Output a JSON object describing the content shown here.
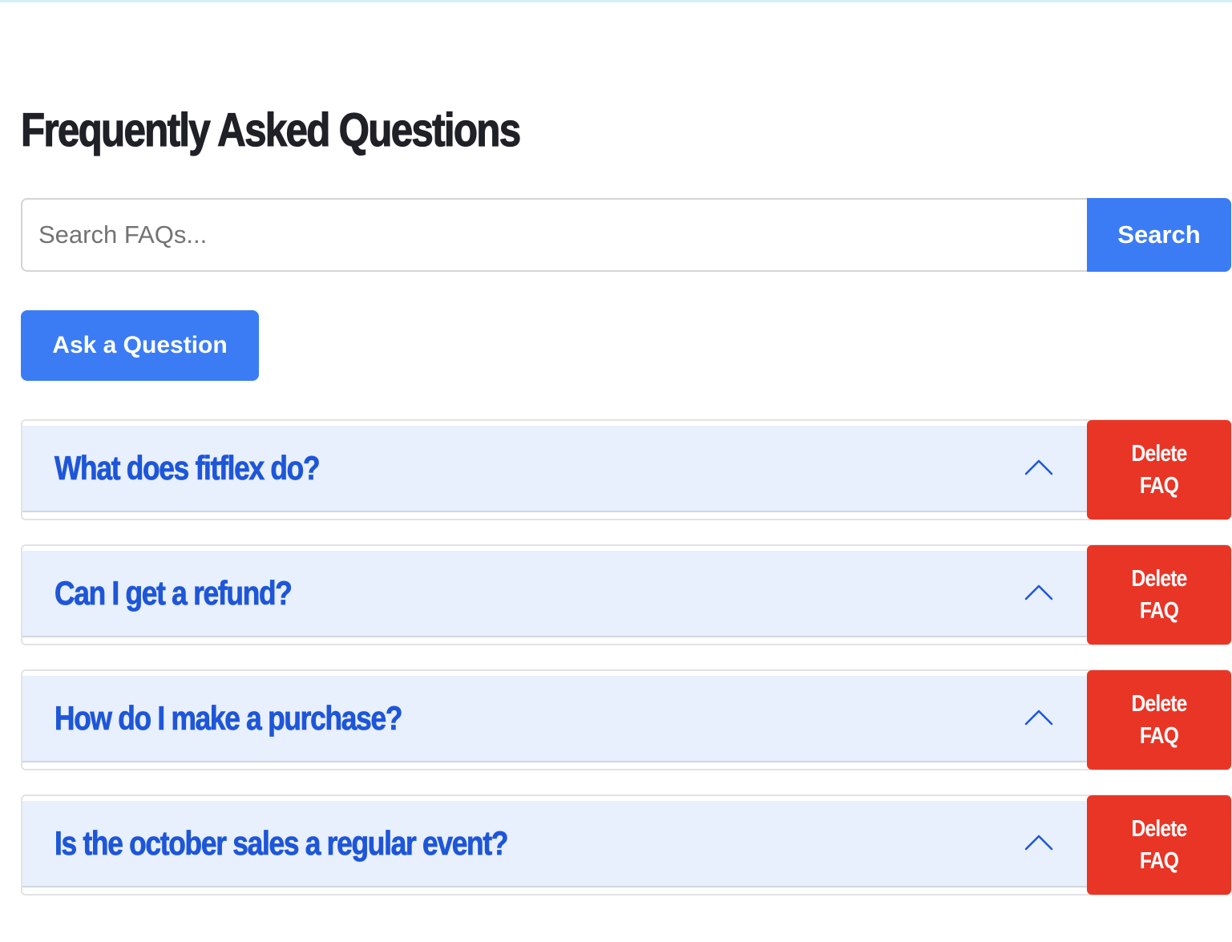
{
  "page": {
    "title": "Frequently Asked Questions"
  },
  "search": {
    "placeholder": "Search FAQs...",
    "value": "",
    "button_label": "Search"
  },
  "ask_button_label": "Ask a Question",
  "faqs": [
    {
      "question": "What does fitflex do?",
      "delete_label": "Delete FAQ"
    },
    {
      "question": "Can I get a refund?",
      "delete_label": "Delete FAQ"
    },
    {
      "question": "How do I make a purchase?",
      "delete_label": "Delete FAQ"
    },
    {
      "question": "Is the october sales a regular event?",
      "delete_label": "Delete FAQ"
    }
  ],
  "icons": {
    "chevron": "chevron-up-icon"
  },
  "colors": {
    "primary": "#3b7cf5",
    "danger": "#e93526",
    "question_text": "#1e56d8",
    "faq_header_bg": "#e8effd",
    "title_text": "#1f2127"
  }
}
